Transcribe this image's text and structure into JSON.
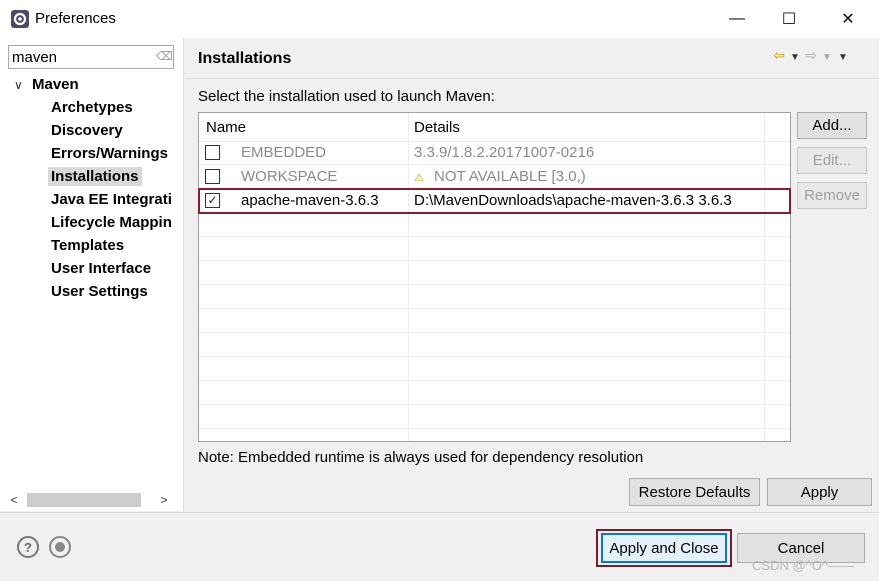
{
  "window": {
    "title": "Preferences",
    "controls": {
      "minimize": "—",
      "maximize": "☐",
      "close": "✕"
    }
  },
  "filter": {
    "value": "maven"
  },
  "tree": {
    "root": "Maven",
    "items": [
      {
        "label": "Archetypes",
        "selected": false
      },
      {
        "label": "Discovery",
        "selected": false
      },
      {
        "label": "Errors/Warnings",
        "selected": false
      },
      {
        "label": "Installations",
        "selected": true
      },
      {
        "label": "Java EE Integrati",
        "selected": false
      },
      {
        "label": "Lifecycle Mappin",
        "selected": false
      },
      {
        "label": "Templates",
        "selected": false
      },
      {
        "label": "User Interface",
        "selected": false
      },
      {
        "label": "User Settings",
        "selected": false
      }
    ]
  },
  "page": {
    "title": "Installations",
    "instruction": "Select the installation used to launch Maven:",
    "note": "Note: Embedded runtime is always used for dependency resolution"
  },
  "table": {
    "headers": {
      "name": "Name",
      "details": "Details"
    },
    "rows": [
      {
        "checked": false,
        "name": "EMBEDDED",
        "details": "3.3.9/1.8.2.20171007-0216",
        "disabled": true
      },
      {
        "checked": false,
        "name": "WORKSPACE",
        "details": "NOT AVAILABLE [3.0,)",
        "disabled": true,
        "warning": true
      },
      {
        "checked": true,
        "name": "apache-maven-3.6.3",
        "details": "D:\\MavenDownloads\\apache-maven-3.6.3 3.6.3",
        "disabled": false
      }
    ]
  },
  "buttons": {
    "add": "Add...",
    "edit": "Edit...",
    "remove": "Remove",
    "restore_defaults": "Restore Defaults",
    "apply": "Apply",
    "apply_and_close": "Apply and Close",
    "cancel": "Cancel"
  },
  "watermark": "CSDN @^O^——",
  "colors": {
    "highlight_border": "#8b1a2f",
    "focus_blue": "#0078d7",
    "warning": "#d4a000"
  }
}
